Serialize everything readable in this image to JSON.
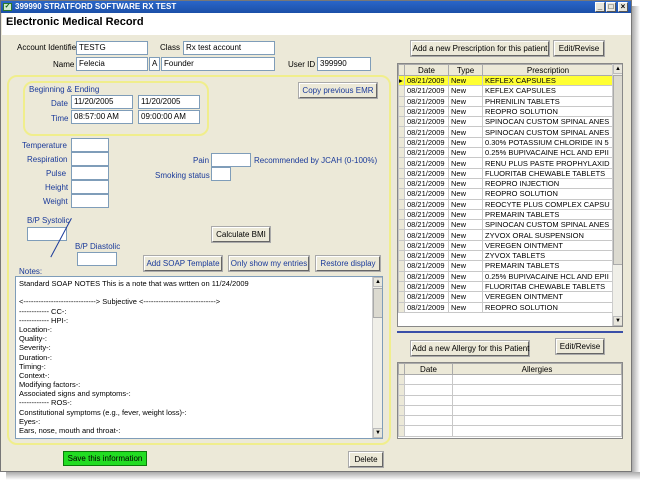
{
  "window": {
    "title": "399990 STRATFORD SOFTWARE RX TEST",
    "header": "Electronic Medical Record",
    "min": "_",
    "max": "□",
    "close": "×"
  },
  "patient": {
    "account_label": "Account Identifier",
    "account": "TESTG",
    "class_label": "Class",
    "class": "Rx test account",
    "name_label": "Name",
    "first": "Felecia",
    "middle": "A",
    "last": "Founder",
    "userid_label": "User ID",
    "userid": "399990"
  },
  "visit": {
    "group_label": "Beginning & Ending",
    "date_label": "Date",
    "date_start": "11/20/2005",
    "date_end": "11/20/2005",
    "time_label": "Time",
    "time_start": "08:57:00 AM",
    "time_end": "09:00:00 AM",
    "copy_prev": "Copy previous EMR"
  },
  "vitals": {
    "temperature": "Temperature",
    "respiration": "Respiration",
    "pulse": "Pulse",
    "height": "Height",
    "weight": "Weight",
    "pain": "Pain",
    "pain_note": "Recommended by JCAH (0-100%)",
    "smoking": "Smoking status",
    "bp_sys": "B/P Systolic",
    "bp_dia": "B/P Diastolic",
    "calc_bmi": "Calculate BMI"
  },
  "notes": {
    "label": "Notes:",
    "add_soap": "Add SOAP Template",
    "only_mine": "Only show my entries",
    "restore": "Restore display",
    "lines": [
      "Standard SOAP NOTES   This is a note that was wrtten on 11/24/2009",
      "",
      "<-----------------------------> Subjective <----------------------------->",
      "------------ CC-:",
      "------------ HPI-:",
      "Location-:",
      "Quality-:",
      "Severity-:",
      "Duration-:",
      "Timing-:",
      "Context-:",
      "Modifying factors-:",
      "Associated signs and symptoms-:",
      "------------ ROS-:",
      "Constitutional symptoms (e.g., fever, weight loss)-:",
      "Eyes-:",
      "Ears, nose, mouth and throat-:"
    ]
  },
  "footer": {
    "save": "Save this information",
    "delete": "Delete"
  },
  "rx": {
    "add": "Add a new Prescription for this patient",
    "edit": "Edit/Revise",
    "headers": [
      "Date",
      "Type",
      "Prescription"
    ],
    "rows": [
      [
        "08/21/2009",
        "New",
        "KEFLEX CAPSULES"
      ],
      [
        "08/21/2009",
        "New",
        "KEFLEX CAPSULES"
      ],
      [
        "08/21/2009",
        "New",
        "PHRENILIN TABLETS"
      ],
      [
        "08/21/2009",
        "New",
        "REOPRO SOLUTION"
      ],
      [
        "08/21/2009",
        "New",
        "SPINOCAN CUSTOM SPINAL ANES"
      ],
      [
        "08/21/2009",
        "New",
        "SPINOCAN CUSTOM SPINAL ANES"
      ],
      [
        "08/21/2009",
        "New",
        "0.30% POTASSIUM CHLORIDE IN 5"
      ],
      [
        "08/21/2009",
        "New",
        "0.25% BUPIVACAINE HCL AND EPII"
      ],
      [
        "08/21/2009",
        "New",
        "RENU PLUS PASTE PROPHYLAXID"
      ],
      [
        "08/21/2009",
        "New",
        "FLUORITAB CHEWABLE TABLETS"
      ],
      [
        "08/21/2009",
        "New",
        "REOPRO INJECTION"
      ],
      [
        "08/21/2009",
        "New",
        "REOPRO SOLUTION"
      ],
      [
        "08/21/2009",
        "New",
        "REOCYTE PLUS COMPLEX CAPSU"
      ],
      [
        "08/21/2009",
        "New",
        "PREMARIN TABLETS"
      ],
      [
        "08/21/2009",
        "New",
        "SPINOCAN CUSTOM SPINAL ANES"
      ],
      [
        "08/21/2009",
        "New",
        "ZYVOX ORAL SUSPENSION"
      ],
      [
        "08/21/2009",
        "New",
        "VEREGEN OINTMENT"
      ],
      [
        "08/21/2009",
        "New",
        "ZYVOX TABLETS"
      ],
      [
        "08/21/2009",
        "New",
        "PREMARIN TABLETS"
      ],
      [
        "08/21/2009",
        "New",
        "0.25% BUPIVACAINE HCL AND EPII"
      ],
      [
        "08/21/2009",
        "New",
        "FLUORITAB CHEWABLE TABLETS"
      ],
      [
        "08/21/2009",
        "New",
        "VEREGEN OINTMENT"
      ],
      [
        "08/21/2009",
        "New",
        "REOPRO SOLUTION"
      ]
    ]
  },
  "allergy": {
    "add": "Add a new Allergy for this Patient",
    "edit": "Edit/Revise",
    "headers": [
      "Date",
      "Allergies"
    ]
  }
}
